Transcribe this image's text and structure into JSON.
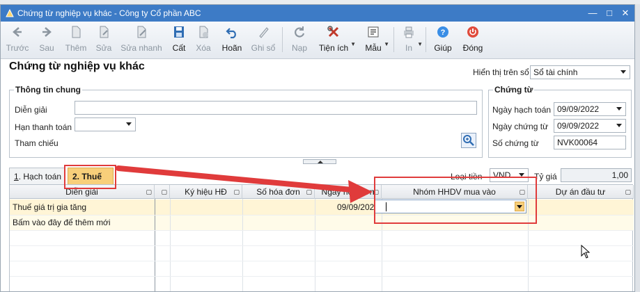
{
  "window": {
    "title": "Chứng từ nghiệp vụ khác - Công ty Cổ phần ABC",
    "minimize_icon": "minimize-icon",
    "maximize_icon": "maximize-icon",
    "close_icon": "close-icon"
  },
  "toolbar": {
    "prev": "Trước",
    "next": "Sau",
    "add": "Thêm",
    "edit": "Sửa",
    "quick_edit": "Sửa nhanh",
    "save": "Cất",
    "delete": "Xóa",
    "undo": "Hoãn",
    "post": "Ghi sổ",
    "reload": "Nạp",
    "utilities": "Tiện ích",
    "templates": "Mẫu",
    "print": "In",
    "help": "Giúp",
    "close": "Đóng"
  },
  "form": {
    "title": "Chứng từ nghiệp vụ khác",
    "ledger_label": "Hiển thị trên sổ",
    "ledger_value": "Sổ tài chính",
    "general": {
      "title": "Thông tin chung",
      "description_label": "Diễn giải",
      "description_value": "",
      "due_label": "Hạn thanh toán",
      "due_value": "",
      "reference_label": "Tham chiếu"
    },
    "voucher": {
      "title": "Chứng từ",
      "posting_date_label": "Ngày hạch toán",
      "posting_date": "09/09/2022",
      "voucher_date_label": "Ngày chứng từ",
      "voucher_date": "09/09/2022",
      "voucher_no_label": "Số chứng từ",
      "voucher_no": "NVK00064"
    }
  },
  "tabs": [
    {
      "label": "1. Hạch toán",
      "key": "1",
      "rest": ". Hạch toán"
    },
    {
      "label": "2. Thuế",
      "active": true
    }
  ],
  "currency": {
    "label": "Loại tiền",
    "value": "VND",
    "rate_label": "Tỷ giá",
    "rate_value": "1,00"
  },
  "grid": {
    "columns": [
      "Diễn giải",
      "",
      "Ký hiệu HĐ",
      "Số hóa đơn",
      "Ngày hóa đơn",
      "Nhóm HHDV mua vào",
      "Dự án đầu tư"
    ],
    "rows": [
      {
        "description": "Thuế giá trị gia tăng",
        "invoice_date": "09/09/2022"
      },
      {
        "description": "Bấm vào đây để thêm mới"
      }
    ]
  },
  "colors": {
    "titlebar": "#3d7bc6",
    "active_tab": "#f8cf7a",
    "highlight": "#e03b3b"
  }
}
